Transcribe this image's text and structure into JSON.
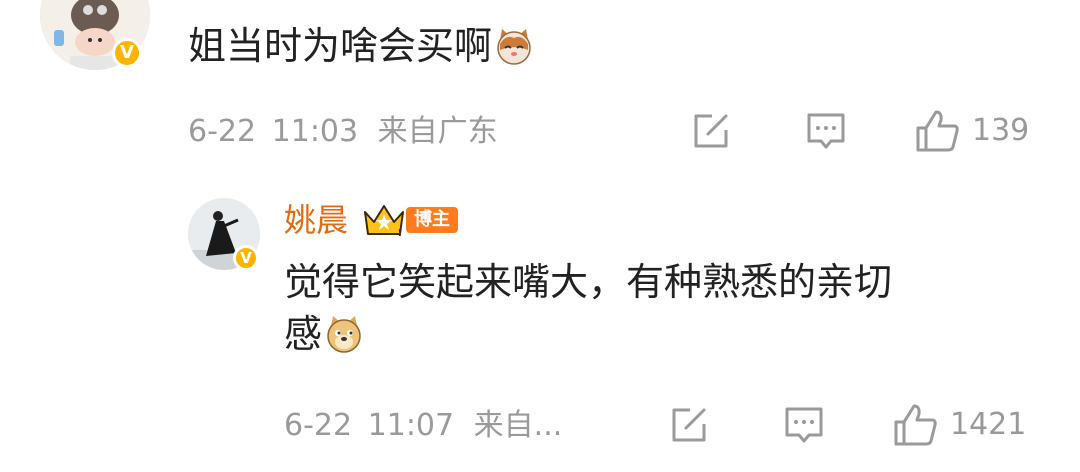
{
  "comment": {
    "text": "姐当时为啥会买啊",
    "emoji": "cat-face-icon",
    "date": "6-22",
    "time": "11:03",
    "location": "来自广东",
    "like_count": "139"
  },
  "reply": {
    "username": "姚晨",
    "tag": "博主",
    "text_line1": "觉得它笑起来嘴大，有种熟悉的亲切",
    "text_line2": "感",
    "emoji": "doge-icon",
    "date": "6-22",
    "time": "11:07",
    "location": "来自...",
    "like_count": "1421"
  },
  "badge_letter": "V",
  "colors": {
    "username": "#e26c11",
    "meta": "#9a9a9a",
    "badge": "#ffb400",
    "tag": "#ff7b1c"
  }
}
